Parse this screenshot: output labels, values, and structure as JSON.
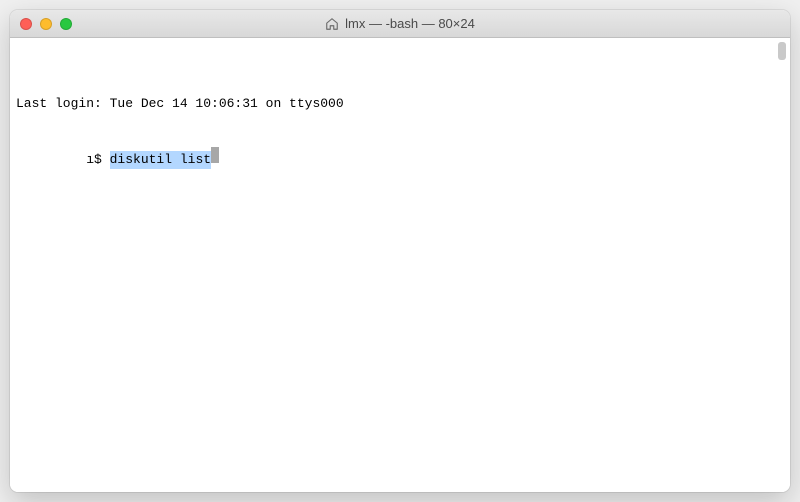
{
  "window": {
    "title": "lmx — -bash — 80×24"
  },
  "terminal": {
    "last_login": "Last login: Tue Dec 14 10:06:31 on ttys000",
    "prompt_user_host": "         ı$ ",
    "command": "diskutil list"
  }
}
